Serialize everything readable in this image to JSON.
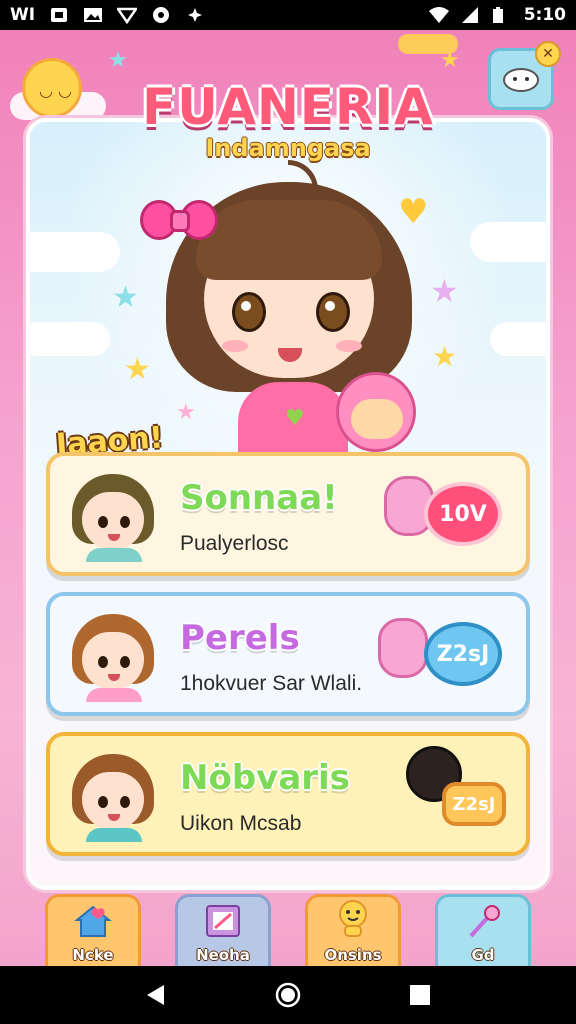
{
  "status_bar": {
    "left_text": "WI",
    "time": "5:10",
    "icons": [
      "sim-icon",
      "image-icon",
      "signal-icon",
      "settings-icon",
      "sparkle-icon",
      "wifi-icon",
      "cell-signal-icon",
      "battery-icon"
    ]
  },
  "header": {
    "title": "FUANERIA",
    "subtitle": "Indamngasa"
  },
  "section": {
    "label": "Iaaon!"
  },
  "cards": [
    {
      "title": "Sonnaa!",
      "subtitle": "Pualyerlosc",
      "badge": "10V",
      "accent": "#7ed957"
    },
    {
      "title": "Perels",
      "subtitle": "1hokvuer Sar Wlali.",
      "badge": "Z2sJ",
      "accent": "#c56ae0"
    },
    {
      "title": "Nöbvaris",
      "subtitle": "Uikon Mcsab",
      "badge": "Z2sJ",
      "accent": "#7ed957"
    }
  ],
  "bottom_nav": [
    {
      "label": "Ncke",
      "icon": "home-heart-icon"
    },
    {
      "label": "Neoha",
      "icon": "photo-frame-icon"
    },
    {
      "label": "Onsins",
      "icon": "star-character-icon"
    },
    {
      "label": "Gd",
      "icon": "magic-wand-icon"
    }
  ],
  "colors": {
    "background": "#f07fb8",
    "panel": "#d7f0fb",
    "title_red": "#ff4f6d",
    "subtitle_yellow": "#ffd54f"
  }
}
